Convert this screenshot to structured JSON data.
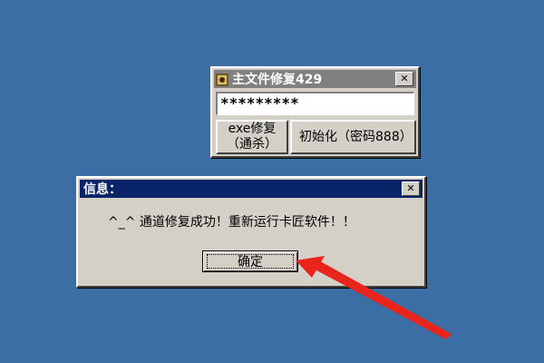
{
  "repair_window": {
    "title": "主文件修复429",
    "close_glyph": "✕",
    "password_value": "*********",
    "button_exe_repair": "exe修复（通杀）",
    "button_initialize": "初始化（密码888）"
  },
  "info_dialog": {
    "title": "信息：",
    "close_glyph": "✕",
    "message": "^_^ 通道修复成功！重新运行卡匠软件！！",
    "ok_label": "确定"
  },
  "colors": {
    "desktop": "#3a6ea5",
    "active_title": "#0a246a",
    "inactive_title": "#808080",
    "arrow": "#e8241c"
  }
}
